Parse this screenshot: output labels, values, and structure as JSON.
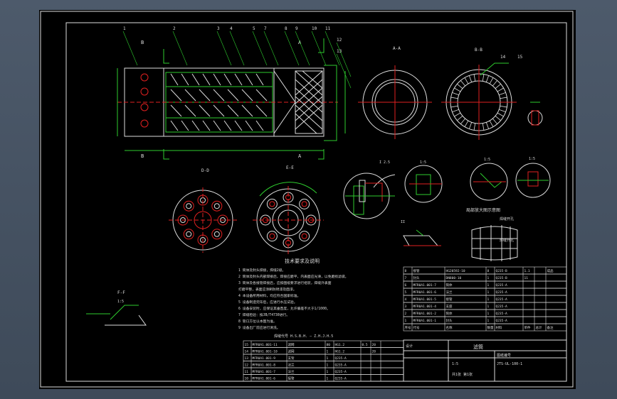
{
  "drawing": {
    "balloons": [
      "1",
      "2",
      "3",
      "4",
      "5",
      "7",
      "8",
      "9",
      "10",
      "11",
      "12",
      "13"
    ],
    "balloons_right": [
      "14",
      "15"
    ],
    "section_labels": {
      "A_A": "A-A",
      "B_B": "B-B",
      "D_D": "D-D",
      "E_E": "E-E",
      "F_F": "F-F"
    },
    "detail_scale": "1:5",
    "notes_title": "技术要求及说明",
    "notes": [
      "1 筒体及封头焊接，焊缝2级。",
      "2 筒体及封头内部焊接后，焊接应磨平，内表面应光滑，以免磨损滤袋。",
      "3 筒体及各接管焊接后，应按图纸要求进行组装，焊缝外表面",
      "  打磨平整，表面应涂刷防锈漆及面漆。",
      "4 本设备所用材料，均应符合国家标准。",
      "5 设备制造完毕后，应进行水压试验。",
      "6 设备安装时，应保证其垂直度，允许偏差不大于1/1000。",
      "7 焊缝检验：按JB/T4730进行。",
      "8 管口方位以本图为准。",
      "9 设备出厂前应进行清洗。"
    ],
    "weld_note": "焊缝代号 H.S.B.H.  — Z.H.J.H.5",
    "caption_mid": "局部放大图示意图",
    "caption_weld1": "焊缝开孔",
    "caption_weld2": "焊缝开孔",
    "title_block": {
      "design": "设计",
      "drawing_title": "滤筒",
      "drawing_no": "JTS-UL-100-1",
      "scale": "1:5",
      "sheet": "共1张 第1张",
      "company": "图纸编号"
    },
    "bom_upper": [
      [
        "8",
        "接管",
        "HG20592-10",
        "8",
        "Q235-B",
        "1.1",
        "",
        "成品"
      ],
      [
        "7",
        "封头",
        "DN800-10",
        "1",
        "Q235-B",
        "11",
        "",
        ""
      ],
      [
        "6",
        "MFR0A1.001-7",
        "筒体",
        "1",
        "Q235-A",
        "",
        "",
        ""
      ],
      [
        "5",
        "MFR0A1.001-6",
        "法兰",
        "1",
        "Q235-A",
        "",
        "",
        ""
      ],
      [
        "4",
        "MFR0A1.001-5",
        "接管",
        "1",
        "Q235-A",
        "",
        "",
        ""
      ],
      [
        "3",
        "MFR0A1.001-4",
        "支座",
        "1",
        "Q235-A",
        "",
        "",
        ""
      ],
      [
        "2",
        "MFR0A1.001-2",
        "筒体",
        "1",
        "Q235-A",
        "",
        "",
        ""
      ],
      [
        "1",
        "MFR0A1.001-1",
        "封头",
        "1",
        "Q235-A",
        "",
        "",
        ""
      ]
    ],
    "bom_upper_header": [
      "序号",
      "代号",
      "名称",
      "数量",
      "材料",
      "单件",
      "总计",
      "备注"
    ],
    "bom_lower": [
      [
        "15",
        "MFR0A1.001-11",
        "滤网",
        "80",
        "HG1.2",
        "0.5",
        "20",
        ""
      ],
      [
        "14",
        "MFR0A1.001-10",
        "滤网",
        "1",
        "HG1.2",
        "",
        "20",
        ""
      ],
      [
        "13",
        "MFR0A1.001-9",
        "支架",
        "1",
        "Q235-A",
        "",
        "",
        ""
      ],
      [
        "12",
        "MFR0A1.001-8",
        "法兰",
        "1",
        "Q235-A",
        "",
        "",
        ""
      ],
      [
        "11",
        "MFR0A1.001-7",
        "法兰",
        "1",
        "Q235-A",
        "",
        "",
        ""
      ],
      [
        "10",
        "MFR0A1.001-6",
        "接管",
        "1",
        "Q235-A",
        "",
        "",
        ""
      ]
    ]
  }
}
